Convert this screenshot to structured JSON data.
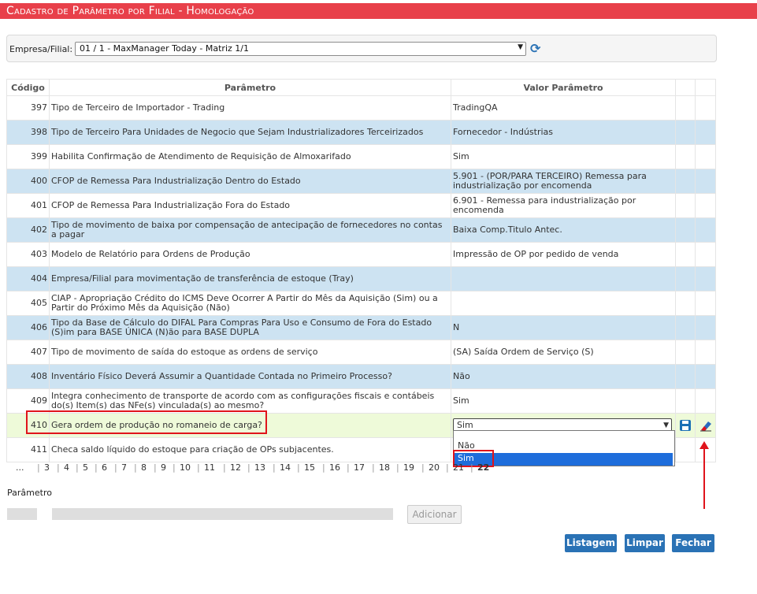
{
  "page": {
    "title": "Cadastro de Parâmetro por Filial  - Homologação"
  },
  "filter": {
    "label": "Empresa/Filial:",
    "selected": "01 / 1 - MaxManager Today - Matriz 1/1",
    "refresh_icon": "refresh-icon"
  },
  "table": {
    "headers": {
      "codigo": "Código",
      "parametro": "Parâmetro",
      "valor": "Valor Parâmetro"
    },
    "rows": [
      {
        "codigo": "397",
        "parametro": "Tipo de Terceiro de Importador - Trading",
        "valor": "TradingQA"
      },
      {
        "codigo": "398",
        "parametro": "Tipo de Terceiro Para Unidades de Negocio que Sejam Industrializadores Terceirizados",
        "valor": "Fornecedor - Indústrias"
      },
      {
        "codigo": "399",
        "parametro": "Habilita Confirmação de Atendimento de Requisição de Almoxarifado",
        "valor": "Sim"
      },
      {
        "codigo": "400",
        "parametro": "CFOP de Remessa Para Industrialização Dentro do Estado",
        "valor": "5.901 - (POR/PARA TERCEIRO) Remessa para industrialização por encomenda"
      },
      {
        "codigo": "401",
        "parametro": "CFOP de Remessa Para Industrialização Fora do Estado",
        "valor": "6.901 - Remessa para industrialização por encomenda"
      },
      {
        "codigo": "402",
        "parametro": "Tipo de movimento de baixa por compensação de antecipação de fornecedores no contas a pagar",
        "valor": "Baixa Comp.Titulo Antec."
      },
      {
        "codigo": "403",
        "parametro": "Modelo de Relatório para Ordens de Produção",
        "valor": "Impressão de OP por pedido de venda"
      },
      {
        "codigo": "404",
        "parametro": "Empresa/Filial para movimentação de transferência de estoque (Tray)",
        "valor": ""
      },
      {
        "codigo": "405",
        "parametro": "CIAP - Apropriação Crédito do ICMS Deve Ocorrer A Partir do Mês da Aquisição (Sim) ou a Partir do Próximo Mês da Aquisição (Não)",
        "valor": ""
      },
      {
        "codigo": "406",
        "parametro": "Tipo da Base de Cálculo do DIFAL Para Compras Para Uso e Consumo de Fora do Estado (S)im para BASE ÚNICA (N)ão para BASE DUPLA",
        "valor": "N"
      },
      {
        "codigo": "407",
        "parametro": "Tipo de movimento de saída do estoque as ordens de serviço",
        "valor": "(SA) Saída Ordem de Serviço (S)"
      },
      {
        "codigo": "408",
        "parametro": "Inventário Físico Deverá Assumir a Quantidade Contada no Primeiro Processo?",
        "valor": "Não"
      },
      {
        "codigo": "409",
        "parametro": "Integra conhecimento de transporte de acordo com as configurações fiscais e contábeis do(s) Item(s) das NFe(s) vinculada(s) ao mesmo?",
        "valor": "Sim"
      },
      {
        "codigo": "410",
        "parametro": "Gera ordem de produção no romaneio de carga?",
        "valor": "Sim"
      },
      {
        "codigo": "411",
        "parametro": "Checa saldo líquido do estoque para criação de OPs subjacentes.",
        "valor": ""
      }
    ],
    "edit_row": {
      "select_value": "Sim",
      "options": [
        "Não",
        "Sim"
      ],
      "save_icon": "save-icon",
      "edit_icon": "eraser-icon"
    }
  },
  "pager": {
    "pages": [
      "...",
      "3",
      "4",
      "5",
      "6",
      "7",
      "8",
      "9",
      "10",
      "11",
      "12",
      "13",
      "14",
      "15",
      "16",
      "17",
      "18",
      "19",
      "20",
      "21",
      "22"
    ],
    "current": "22"
  },
  "form": {
    "label": "Parâmetro",
    "add_button": "Adicionar"
  },
  "actions": {
    "listagem": "Listagem",
    "limpar": "Limpar",
    "fechar": "Fechar"
  }
}
